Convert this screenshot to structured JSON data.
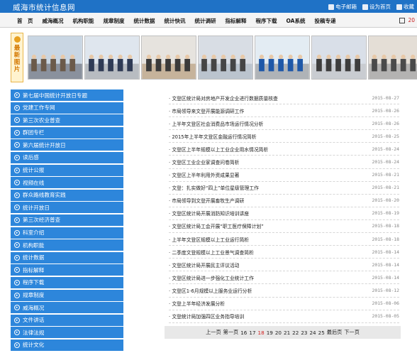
{
  "header": {
    "site_title": "威海市统计信息网",
    "links": [
      {
        "label": "电子邮箱",
        "icon": "mail-icon"
      },
      {
        "label": "设为首页",
        "icon": "home-icon"
      },
      {
        "label": "收藏",
        "icon": "star-icon"
      }
    ]
  },
  "nav": {
    "items": [
      "首　页",
      "威海概况",
      "机构职能",
      "规章制度",
      "统计数据",
      "统计快讯",
      "统计调研",
      "指标解释",
      "程序下载",
      "OA系统",
      "投稿专递"
    ],
    "date_text": "20"
  },
  "gallery": {
    "tag_label": "最新图片",
    "photos": [
      "photo-1",
      "photo-2",
      "photo-3",
      "photo-4",
      "photo-5",
      "photo-6",
      "photo-7"
    ]
  },
  "sidebar": {
    "items": [
      "第七届中国统计开放日专题",
      "党建工作专网",
      "第三次农业普查",
      "群团专栏",
      "第六届统计开放日",
      "读后感",
      "统计公报",
      "视频在线",
      "群众路线教育实践",
      "统计开放日",
      "第三次经济普查",
      "科室介绍",
      "机构职能",
      "统计数据",
      "指标解释",
      "程序下载",
      "规章制度",
      "威海概况",
      "文件讲话",
      "法律法规",
      "统计文化"
    ]
  },
  "news": {
    "items": [
      {
        "title": "文登区统计局对房地产开发企业进行数据质量核查",
        "date": "2015-08-27"
      },
      {
        "title": "市局领导来文登开展能源调研工作",
        "date": "2015-08-26"
      },
      {
        "title": "上半年文登区社会消费品市场运行情况分析",
        "date": "2015-08-26"
      },
      {
        "title": "2015年上半年文登区金融运行情况简析",
        "date": "2015-08-25"
      },
      {
        "title": "文登区上半年规模以上工业企业用水情况简析",
        "date": "2015-08-24"
      },
      {
        "title": "文登区工业企业家调查问卷简析",
        "date": "2015-08-24"
      },
      {
        "title": "文登区上半年利用外资成果显著",
        "date": "2015-08-21"
      },
      {
        "title": "文登：扎实做好“四上”单位星级管理工作",
        "date": "2015-08-21"
      },
      {
        "title": "市局领导到文登开展畜牧生产调研",
        "date": "2015-08-20"
      },
      {
        "title": "文登区统计局开展消防知识培训讲座",
        "date": "2015-08-19"
      },
      {
        "title": "文登区统计局工会开展“职工医疗保障计划”",
        "date": "2015-08-18"
      },
      {
        "title": "上半年文登区规模以上工业运行简析",
        "date": "2015-08-18"
      },
      {
        "title": "二季度文登规模以上工业景气调查简析",
        "date": "2015-08-14"
      },
      {
        "title": "文登区统计局开展民主评议活动",
        "date": "2015-08-14"
      },
      {
        "title": "文登区统计局进一步强化工业统计工作",
        "date": "2015-08-14"
      },
      {
        "title": "文登区1-6月规模以上服务业运行分析",
        "date": "2015-08-12"
      },
      {
        "title": "文登上半年经济发展分析",
        "date": "2015-08-06"
      },
      {
        "title": "文登统计局加强四区业务指导培训",
        "date": "2015-08-05"
      }
    ]
  },
  "pager": {
    "prev": "上一页",
    "first": "第一页",
    "pages": [
      "16",
      "17",
      "18",
      "19",
      "20",
      "21",
      "22",
      "23",
      "24",
      "25"
    ],
    "current": "18",
    "last": "最后页",
    "next": "下一页"
  },
  "colors": {
    "topbar": "#1f72c6",
    "sidebar": "#2d86db",
    "accent_red": "#d21f1f"
  }
}
